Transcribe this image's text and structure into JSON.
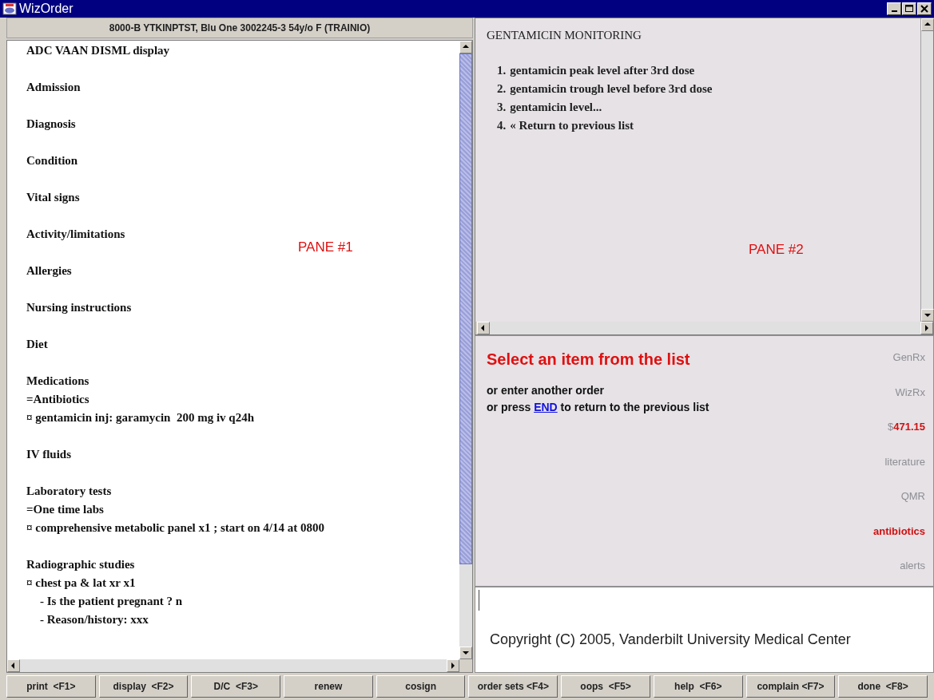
{
  "window": {
    "title": "WizOrder"
  },
  "patient_header": "8000-B YTKINPTST, Blu One 3002245-3 54y/o F (TRAINIO)",
  "pane_1": {
    "annotation": "PANE #1",
    "sections": [
      {
        "lines": [
          {
            "kind": "heading",
            "text": "ADC VAAN DISML display"
          }
        ]
      },
      {
        "lines": [
          {
            "kind": "heading",
            "text": "Admission"
          }
        ]
      },
      {
        "lines": [
          {
            "kind": "heading",
            "text": "Diagnosis"
          }
        ]
      },
      {
        "lines": [
          {
            "kind": "heading",
            "text": "Condition"
          }
        ]
      },
      {
        "lines": [
          {
            "kind": "heading",
            "text": "Vital signs"
          }
        ]
      },
      {
        "lines": [
          {
            "kind": "heading",
            "text": "Activity/limitations"
          }
        ]
      },
      {
        "lines": [
          {
            "kind": "heading",
            "text": "Allergies"
          }
        ]
      },
      {
        "lines": [
          {
            "kind": "heading",
            "text": "Nursing instructions"
          }
        ]
      },
      {
        "lines": [
          {
            "kind": "heading",
            "text": "Diet"
          }
        ]
      },
      {
        "lines": [
          {
            "kind": "heading",
            "text": "Medications"
          },
          {
            "kind": "subheading",
            "text": "=Antibiotics"
          },
          {
            "kind": "order",
            "text": "¤ gentamicin inj: garamycin  200 mg iv q24h"
          }
        ]
      },
      {
        "lines": [
          {
            "kind": "heading",
            "text": "IV fluids"
          }
        ]
      },
      {
        "lines": [
          {
            "kind": "heading",
            "text": "Laboratory tests"
          },
          {
            "kind": "subheading",
            "text": "=One time labs"
          },
          {
            "kind": "order",
            "text": "¤ comprehensive metabolic panel x1 ; start on 4/14 at 0800"
          }
        ]
      },
      {
        "lines": [
          {
            "kind": "heading",
            "text": "Radiographic studies"
          },
          {
            "kind": "order",
            "text": "¤ chest pa & lat xr x1"
          },
          {
            "kind": "detail",
            "text": "- Is the patient pregnant ? n"
          },
          {
            "kind": "detail",
            "text": "- Reason/history: xxx"
          }
        ]
      }
    ]
  },
  "pane_2": {
    "annotation": "PANE #2",
    "title": "GENTAMICIN MONITORING",
    "options": [
      {
        "number": "1.",
        "text": "gentamicin peak level after 3rd dose"
      },
      {
        "number": "2.",
        "text": "gentamicin trough level before 3rd dose"
      },
      {
        "number": "3.",
        "text": "gentamicin level..."
      },
      {
        "number": "4.",
        "text": "« Return to previous list"
      }
    ]
  },
  "message": {
    "prompt": "Select an item from the list",
    "line_1": "or enter another order",
    "line_2_before": "or press",
    "line_2_link": "END",
    "line_2_after": "to return to the previous list"
  },
  "side_links": [
    {
      "kind": "link",
      "label": "GenRx",
      "active": false
    },
    {
      "kind": "link",
      "label": "WizRx",
      "active": false
    },
    {
      "kind": "price",
      "symbol": "$",
      "label": "471.15",
      "active": true
    },
    {
      "kind": "link",
      "label": "literature",
      "active": false
    },
    {
      "kind": "link",
      "label": "QMR",
      "active": false
    },
    {
      "kind": "link",
      "label": "antibiotics",
      "active": true
    },
    {
      "kind": "link",
      "label": "alerts",
      "active": false
    }
  ],
  "copyright": "Copyright (C) 2005, Vanderbilt University Medical Center",
  "buttons": [
    "print  <F1>",
    "display  <F2>",
    "D/C  <F3>",
    "renew",
    "cosign",
    "order sets <F4>",
    "oops  <F5>",
    "help  <F6>",
    "complain <F7>",
    "done  <F8>"
  ]
}
